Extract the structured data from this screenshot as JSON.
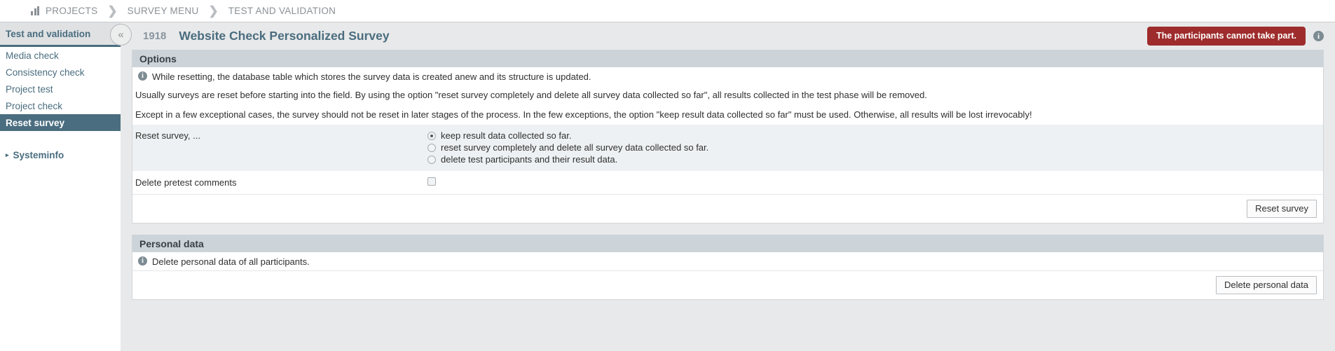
{
  "breadcrumb": {
    "icon": "bar-chart-icon",
    "items": [
      {
        "label": "PROJECTS"
      },
      {
        "label": "SURVEY MENU"
      },
      {
        "label": "TEST AND VALIDATION"
      }
    ],
    "separator": "❯"
  },
  "sidebar": {
    "title": "Test and validation",
    "collapse_icon": "«",
    "items": [
      {
        "label": "Media check",
        "active": false
      },
      {
        "label": "Consistency check",
        "active": false
      },
      {
        "label": "Project test",
        "active": false
      },
      {
        "label": "Project check",
        "active": false
      },
      {
        "label": "Reset survey",
        "active": true
      }
    ],
    "group": {
      "label": "Systeminfo",
      "caret": "▸"
    }
  },
  "header": {
    "survey_id": "1918",
    "survey_title": "Website Check Personalized Survey",
    "status_badge": "The participants cannot take part.",
    "info_icon": "i"
  },
  "options_panel": {
    "heading": "Options",
    "info_note": "While resetting, the database table which stores the survey data is created anew and its structure is updated.",
    "paragraphs": [
      "Usually surveys are reset before starting into the field. By using the option \"reset survey completely and delete all survey data collected so far\", all results collected in the test phase will be removed.",
      "Except in a few exceptional cases, the survey should not be reset in later stages of the process. In the few exceptions, the option \"keep result data collected so far\" must be used. Otherwise, all results will be lost irrevocably!"
    ],
    "reset_label": "Reset survey, ...",
    "reset_options": [
      {
        "label": "keep result data collected so far.",
        "selected": true
      },
      {
        "label": "reset survey completely and delete all survey data collected so far.",
        "selected": false
      },
      {
        "label": "delete test participants and their result data.",
        "selected": false
      }
    ],
    "delete_comments_label": "Delete pretest comments",
    "delete_comments_checked": false,
    "reset_button": "Reset survey"
  },
  "personal_panel": {
    "heading": "Personal data",
    "info_note": "Delete personal data of all participants.",
    "delete_button": "Delete personal data"
  },
  "colors": {
    "accent": "#4a6d7f",
    "danger": "#9e2c2c",
    "panel_head": "#ccd4d9",
    "page_bg": "#e8e9ea"
  }
}
